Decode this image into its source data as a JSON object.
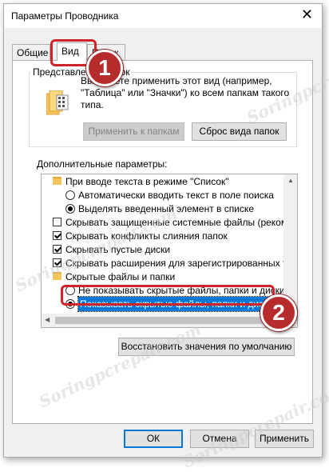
{
  "window": {
    "title": "Параметры Проводника",
    "close_glyph": "✕"
  },
  "tabs": [
    {
      "label": "Общие",
      "active": false
    },
    {
      "label": "Вид",
      "active": true
    },
    {
      "label": "Поиск",
      "active": false
    }
  ],
  "folder_views": {
    "group_label": "Представление папок",
    "description": "Вы можете применить этот вид (например, \"Таблица\" или \"Значки\") ко всем папкам такого типа.",
    "apply_button": "Применить к папкам",
    "reset_button": "Сброс вида папок"
  },
  "advanced": {
    "label": "Дополнительные параметры:",
    "items": [
      {
        "kind": "folder",
        "text": "При вводе текста в режиме \"Список\"",
        "indent": 0
      },
      {
        "kind": "radio",
        "checked": false,
        "text": "Автоматически вводить текст в поле поиска",
        "indent": 1
      },
      {
        "kind": "radio",
        "checked": true,
        "text": "Выделять введенный элемент в списке",
        "indent": 1
      },
      {
        "kind": "checkbox",
        "checked": false,
        "text": "Скрывать защищенные системные файлы (рекомен",
        "indent": 0
      },
      {
        "kind": "checkbox",
        "checked": true,
        "text": "Скрывать конфликты слияния папок",
        "indent": 0
      },
      {
        "kind": "checkbox",
        "checked": true,
        "text": "Скрывать пустые диски",
        "indent": 0
      },
      {
        "kind": "checkbox",
        "checked": true,
        "text": "Скрывать расширения для зарегистрированных типо",
        "indent": 0
      },
      {
        "kind": "folder",
        "text": "Скрытые файлы и папки",
        "indent": 0
      },
      {
        "kind": "radio",
        "checked": false,
        "text": "Не показывать скрытые файлы, папки и диски",
        "indent": 1
      },
      {
        "kind": "radio",
        "checked": true,
        "text": "Показывать скрытые файлы, папки и диски",
        "indent": 1,
        "selected": true
      }
    ]
  },
  "restore_button": "Восстановить значения по умолчанию",
  "footer": {
    "ok": "ОК",
    "cancel": "Отмена",
    "apply": "Применить"
  },
  "annotations": {
    "badge1": "1",
    "badge2": "2",
    "accent": "#b62b2b"
  },
  "watermark": "Soringpcrepair.com"
}
